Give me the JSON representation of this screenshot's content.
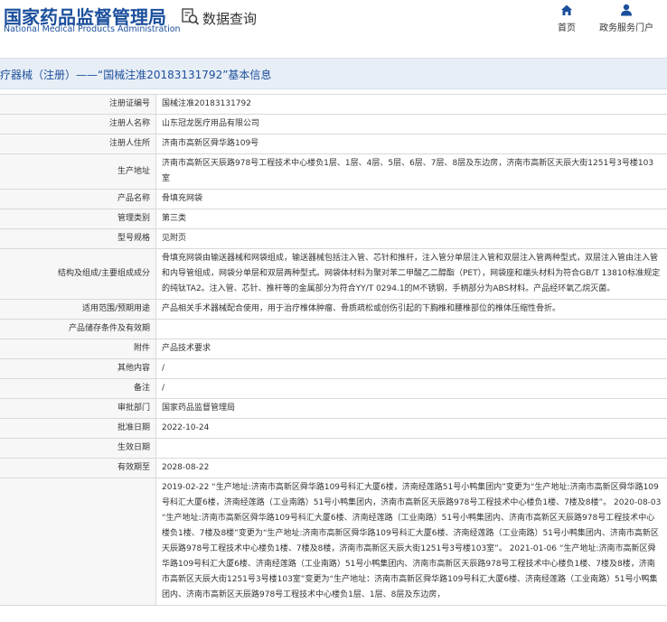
{
  "header": {
    "logo_cn": "国家药品监督管理局",
    "logo_en": "National Medical Products Administration",
    "section_title": "数据查询",
    "nav": [
      {
        "label": "首页",
        "icon": "home-icon"
      },
      {
        "label": "政务服务门户",
        "icon": "user-icon"
      }
    ]
  },
  "title_bar": {
    "text": "疗器械（注册）——“国械注准20183131792”基本信息"
  },
  "rows": [
    {
      "label": "注册证编号",
      "value": "国械注准20183131792"
    },
    {
      "label": "注册人名称",
      "value": "山东冠龙医疗用品有限公司"
    },
    {
      "label": "注册人住所",
      "value": "济南市高新区舜华路109号"
    },
    {
      "label": "生产地址",
      "value": "济南市高新区天辰路978号工程技术中心楼负1层、1层、4层、5层、6层、7层、8层及东边房，济南市高新区天辰大街1251号3号楼103室"
    },
    {
      "label": "产品名称",
      "value": "骨填充网袋"
    },
    {
      "label": "管理类别",
      "value": "第三类"
    },
    {
      "label": "型号规格",
      "value": "见附页"
    },
    {
      "label": "结构及组成/主要组成成分",
      "value": "骨填充网袋由输送器械和网袋组成，输送器械包括注入管、芯针和推杆，注入管分单层注入管和双层注入管两种型式，双层注入管由注入管和内导管组成，网袋分单层和双层两种型式。网袋体材料为聚对苯二甲酸乙二醇酯（PET），网袋座和端头材料为符合GB/T 13810标准规定的纯钛TA2。注入管、芯针、推杆等的金属部分为符合YY/T 0294.1的M不锈钢，手柄部分为ABS材料。产品经环氧乙烷灭菌。"
    },
    {
      "label": "适用范围/预期用途",
      "value": "产品相关手术器械配合使用，用于治疗椎体肿瘤、骨质疏松或创伤引起的下胸椎和腰椎部位的椎体压缩性骨折。"
    },
    {
      "label": "产品储存条件及有效期",
      "value": ""
    },
    {
      "label": "附件",
      "value": "产品技术要求"
    },
    {
      "label": "其他内容",
      "value": "/"
    },
    {
      "label": "备注",
      "value": "/"
    },
    {
      "label": "审批部门",
      "value": "国家药品监督管理局"
    },
    {
      "label": "批准日期",
      "value": "2022-10-24"
    },
    {
      "label": "生效日期",
      "value": ""
    },
    {
      "label": "有效期至",
      "value": "2028-08-22"
    },
    {
      "label": "",
      "value": "2019-02-22 “生产地址:济南市高新区舜华路109号科汇大厦6楼，济南经莲路51号小鸭集团内”变更为“生产地址:济南市高新区舜华路109号科汇大厦6楼，济南经莲路（工业南路）51号小鸭集团内，济南市高新区天辰路978号工程技术中心楼负1楼、7楼及8楼”。 2020-08-03 “生产地址:济南市高新区舜华路109号科汇大厦6楼、济南经莲路（工业南路）51号小鸭集团内、济南市高新区天辰路978号工程技术中心楼负1楼、7楼及8楼”变更为“生产地址:济南市高新区舜华路109号科汇大厦6楼、济南经莲路（工业南路）51号小鸭集团内、济南市高新区天辰路978号工程技术中心楼负1楼、7楼及8楼，济南市高新区天辰大街1251号3号楼103室”。 2021-01-06 “生产地址:济南市高新区舜华路109号科汇大厦6楼、济南经莲路（工业南路）51号小鸭集团内、济南市高新区天辰路978号工程技术中心楼负1楼、7楼及8楼，济南市高新区天辰大街1251号3号楼103室”变更为“生产地址：济南市高新区舜华路109号科汇大厦6楼、济南经莲路（工业南路）51号小鸭集团内、济南市高新区天辰路978号工程技术中心楼负1层、1层、8层及东边房，"
    }
  ]
}
